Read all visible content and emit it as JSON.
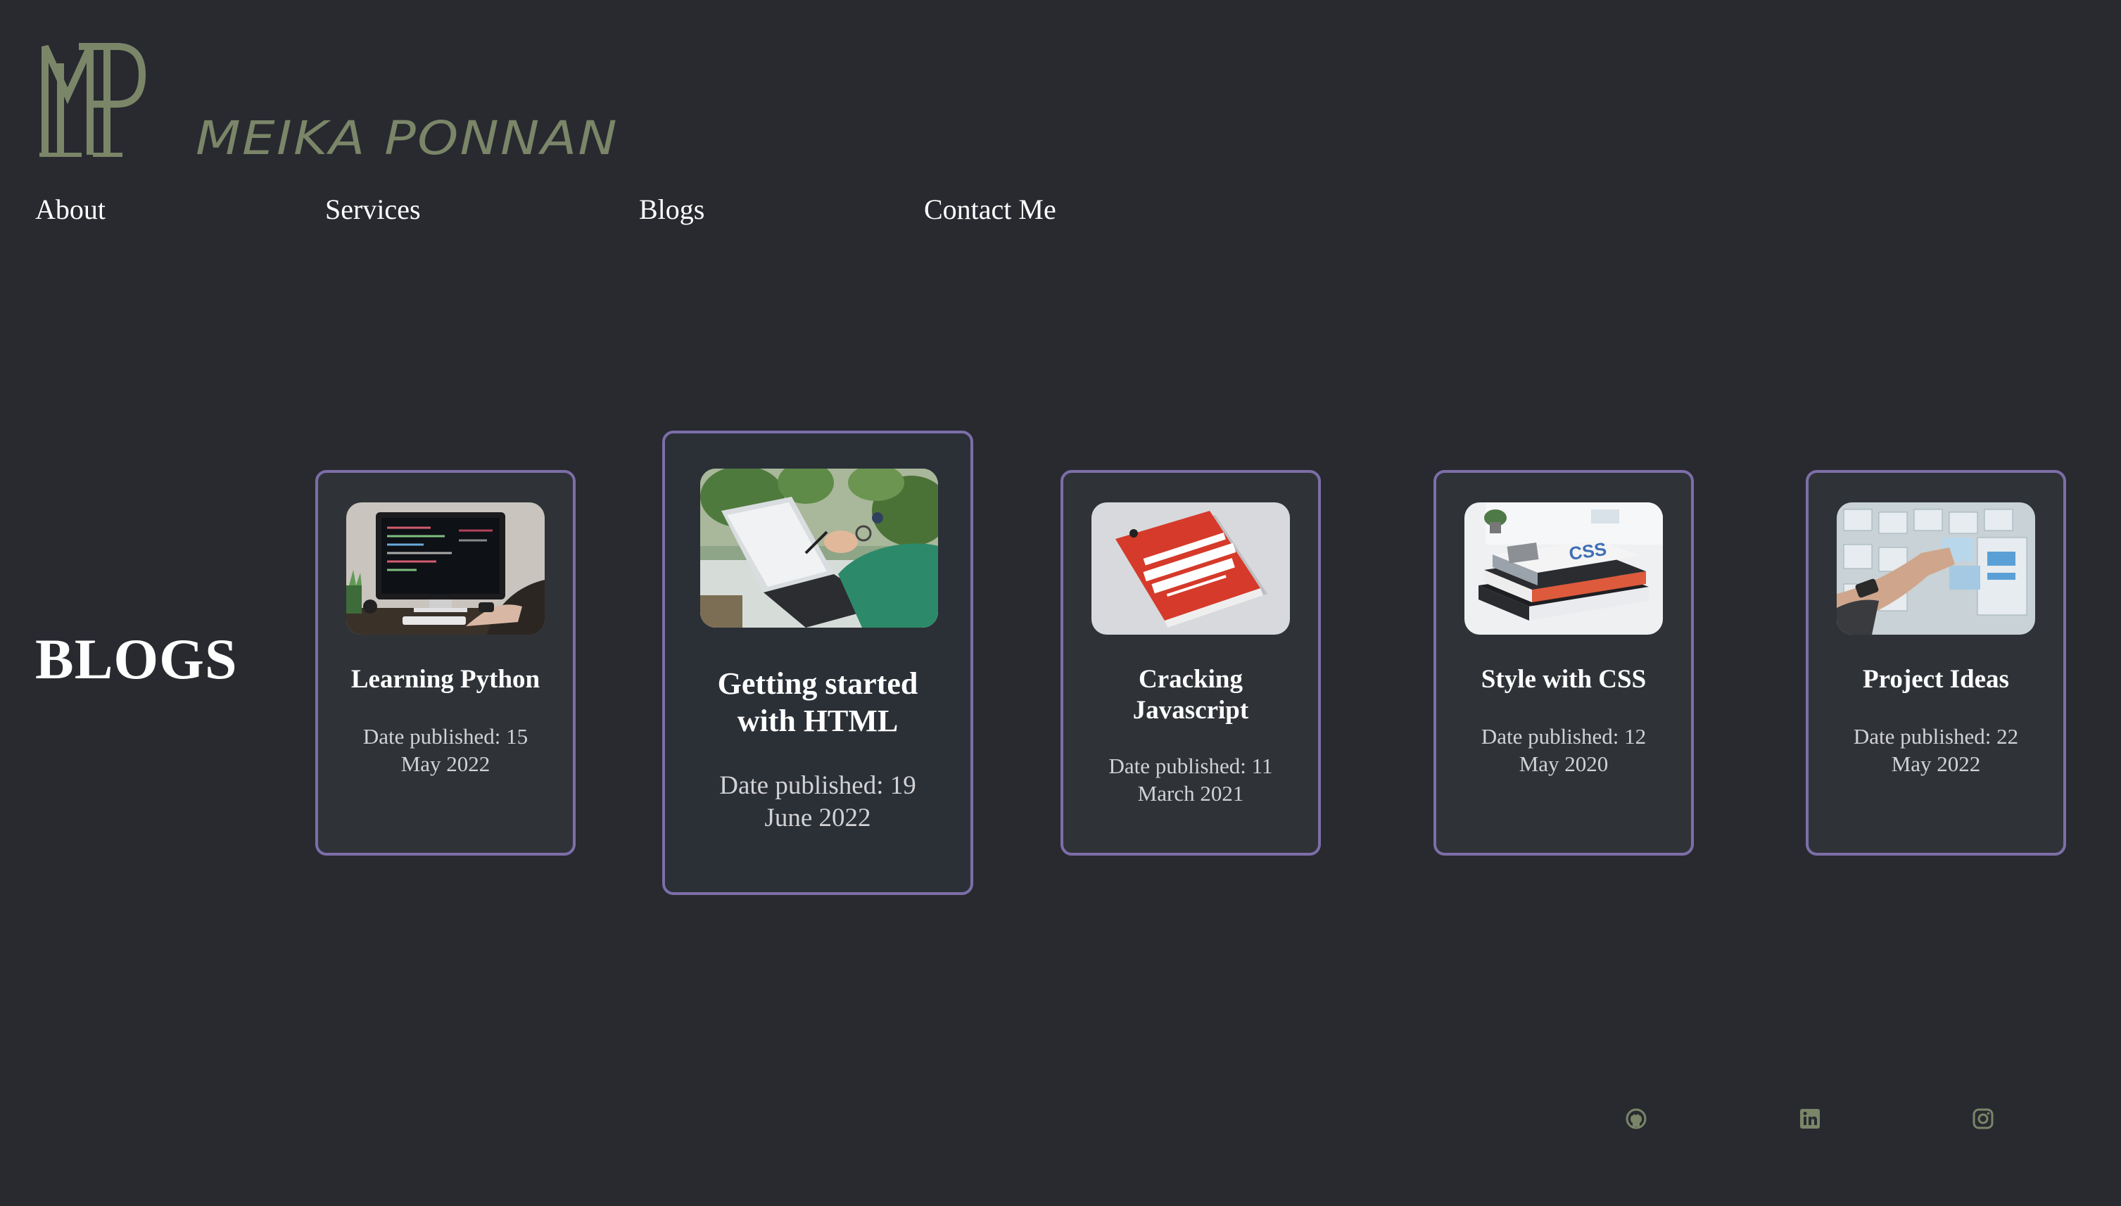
{
  "brand": {
    "name": "MEIKA PONNAN",
    "monogram": "MP",
    "color": "#7b8568"
  },
  "nav": {
    "items": [
      {
        "label": "About"
      },
      {
        "label": "Services"
      },
      {
        "label": "Blogs"
      },
      {
        "label": "Contact Me"
      }
    ]
  },
  "main": {
    "title": "BLOGS",
    "cards": [
      {
        "title": "Learning Python",
        "date": "Date published: 15 May 2022",
        "image": "laptop-code-desk"
      },
      {
        "title": "Getting started with HTML",
        "date": "Date published: 19 June 2022",
        "image": "laptop-plants",
        "featured": true
      },
      {
        "title": "Cracking Javascript",
        "date": "Date published: 11 March 2021",
        "image": "javascript-book"
      },
      {
        "title": "Style with CSS",
        "date": "Date published: 12 May 2020",
        "image": "css-books-stack"
      },
      {
        "title": "Project Ideas",
        "date": "Date published: 22 May 2022",
        "image": "sticky-notes-board"
      }
    ]
  },
  "footer": {
    "icons": [
      "github-icon",
      "linkedin-icon",
      "instagram-icon"
    ]
  },
  "colors": {
    "background": "#282a30",
    "card_border": "#7d6ea8",
    "card_background": "#2f3338",
    "icon_accent": "#7b8568"
  }
}
